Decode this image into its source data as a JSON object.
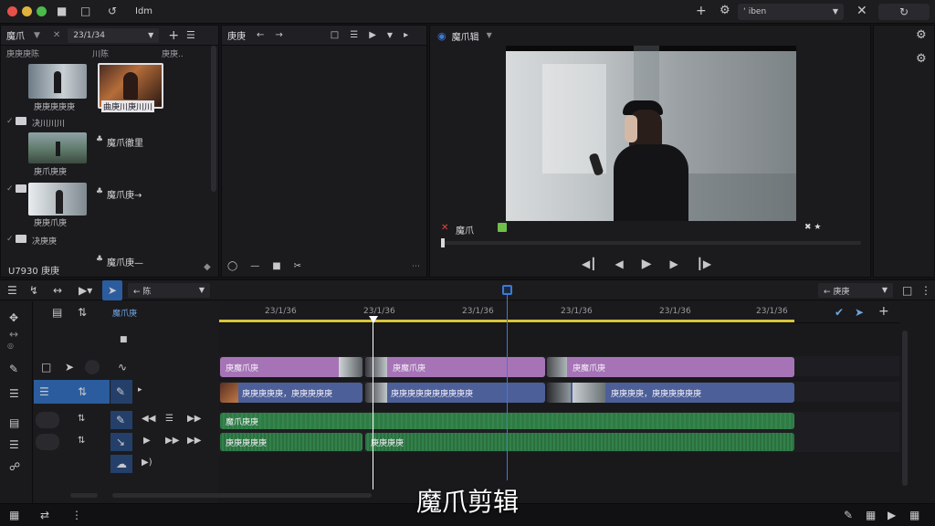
{
  "topbar": {
    "title": "Idm",
    "search_value": "‘ iben",
    "icons": [
      "chart-icon",
      "document-icon",
      "undo-icon",
      "add-icon",
      "settings-icon",
      "close-icon",
      "refresh-icon"
    ]
  },
  "media_panel": {
    "tab_label": "魔爪",
    "date_value": "23/1/34",
    "col1": "庚庚庚陈",
    "col2": "川陈",
    "col3": "庚庚..",
    "items": [
      {
        "label": "庚庚庚庚庚"
      },
      {
        "label": "曲庚川庚川川"
      },
      {
        "group": "决川川川",
        "label": "魔爪徹里",
        "sub": "庚爪庚庚"
      },
      {
        "group": "决庚庚",
        "label": "魔爪庚→",
        "sub": "庚庚爪庚"
      },
      {
        "label": "魔爪庚—"
      }
    ],
    "footer": "U7930 庚庚"
  },
  "effects_panel": {
    "tab_label": "庚庚"
  },
  "viewer": {
    "tab_label": "魔爪辑",
    "clip_name": "魔爪",
    "timecode": "✨——— ★★★★",
    "timecode_text": "✳✳✳✳",
    "readout": "✖ ★★★",
    "time_value": "★★★",
    "tc": "★★"
  },
  "viewer_info": {
    "label": "魔爪",
    "time": "✖ ★"
  },
  "timeline": {
    "left_dropdown": "← 陈",
    "right_dropdown": "← 庚庚",
    "track_label": "魔爪庚",
    "ticks": [
      "23/1/36",
      "23/1/36",
      "23/1/36",
      "23/1/36",
      "23/1/36",
      "23/1/36"
    ],
    "video_clips": [
      {
        "label": "庚魔爪庚"
      },
      {
        "label": "庚魔爪庚"
      },
      {
        "label": "庚魔爪庚"
      }
    ],
    "text_clips": [
      {
        "label": "庚庚庚庚庚，庚庚庚庚庚"
      },
      {
        "label": "庚庚庚庚庚庚庚庚庚庚"
      },
      {
        "label": "庚庚庚庚，庚庚庚庚庚庚"
      }
    ],
    "audio1": {
      "label": "魔爪庚庚"
    },
    "audio2": [
      {
        "label": "庚庚庚庚庚"
      },
      {
        "label": "庚庚庚庚"
      }
    ]
  },
  "caption": "魔爪剪辑",
  "colors": {
    "accent": "#2b5c9e",
    "video_clip": "#a674b6",
    "text_clip": "#4d5f99",
    "audio_clip": "#2f7a45",
    "playhead_white": "#ffffff",
    "playhead_blue": "#3b7ad6",
    "range_yellow": "#d7c43a"
  }
}
